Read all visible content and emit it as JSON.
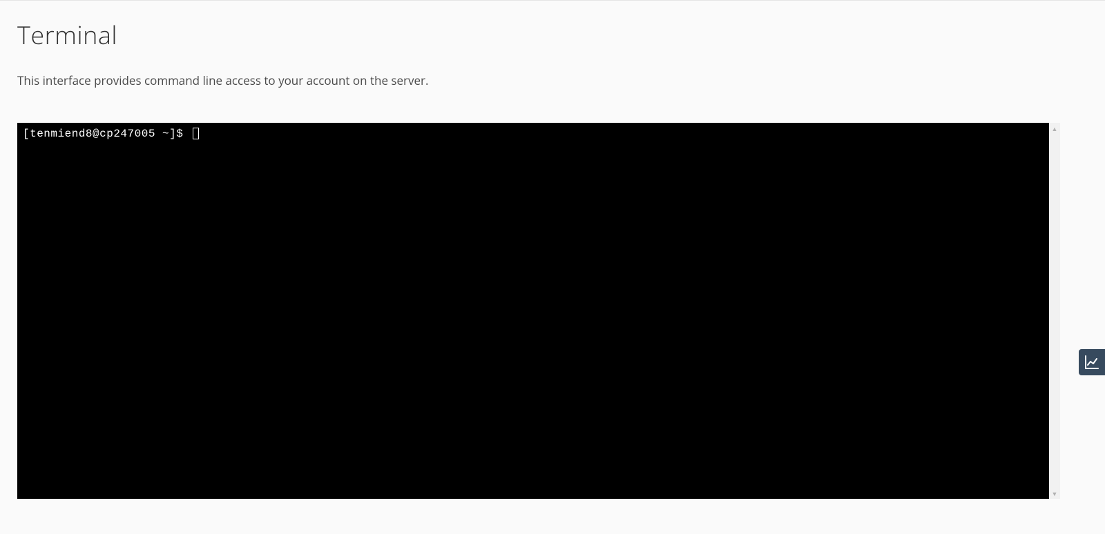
{
  "page": {
    "title": "Terminal",
    "description": "This interface provides command line access to your account on the server."
  },
  "terminal": {
    "prompt": "[tenmiend8@cp247005 ~]$ "
  }
}
